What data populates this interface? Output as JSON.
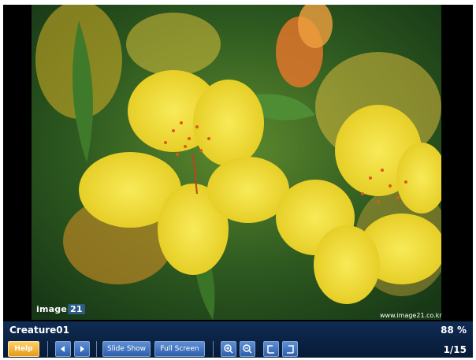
{
  "viewer": {
    "brand_left": "image",
    "brand_box": "21",
    "site_watermark": "www.image21.co.kr"
  },
  "controls": {
    "title": "Creature01",
    "zoom": "88 %",
    "counter": "1/15",
    "help_label": "Help",
    "slideshow_label": "Slide Show",
    "fullscreen_label": "Full Screen",
    "icons": [
      "prev-icon",
      "next-icon",
      "zoom-in-icon",
      "zoom-out-icon",
      "rotate-left-icon",
      "rotate-right-icon"
    ]
  },
  "colors": {
    "bar_top": "#0f2c53",
    "bar_bottom": "#071a36",
    "button": "#2e5fae",
    "help_button": "#e59a1a",
    "flower": "#f4e034",
    "petal_marks": "#d85b1c"
  }
}
